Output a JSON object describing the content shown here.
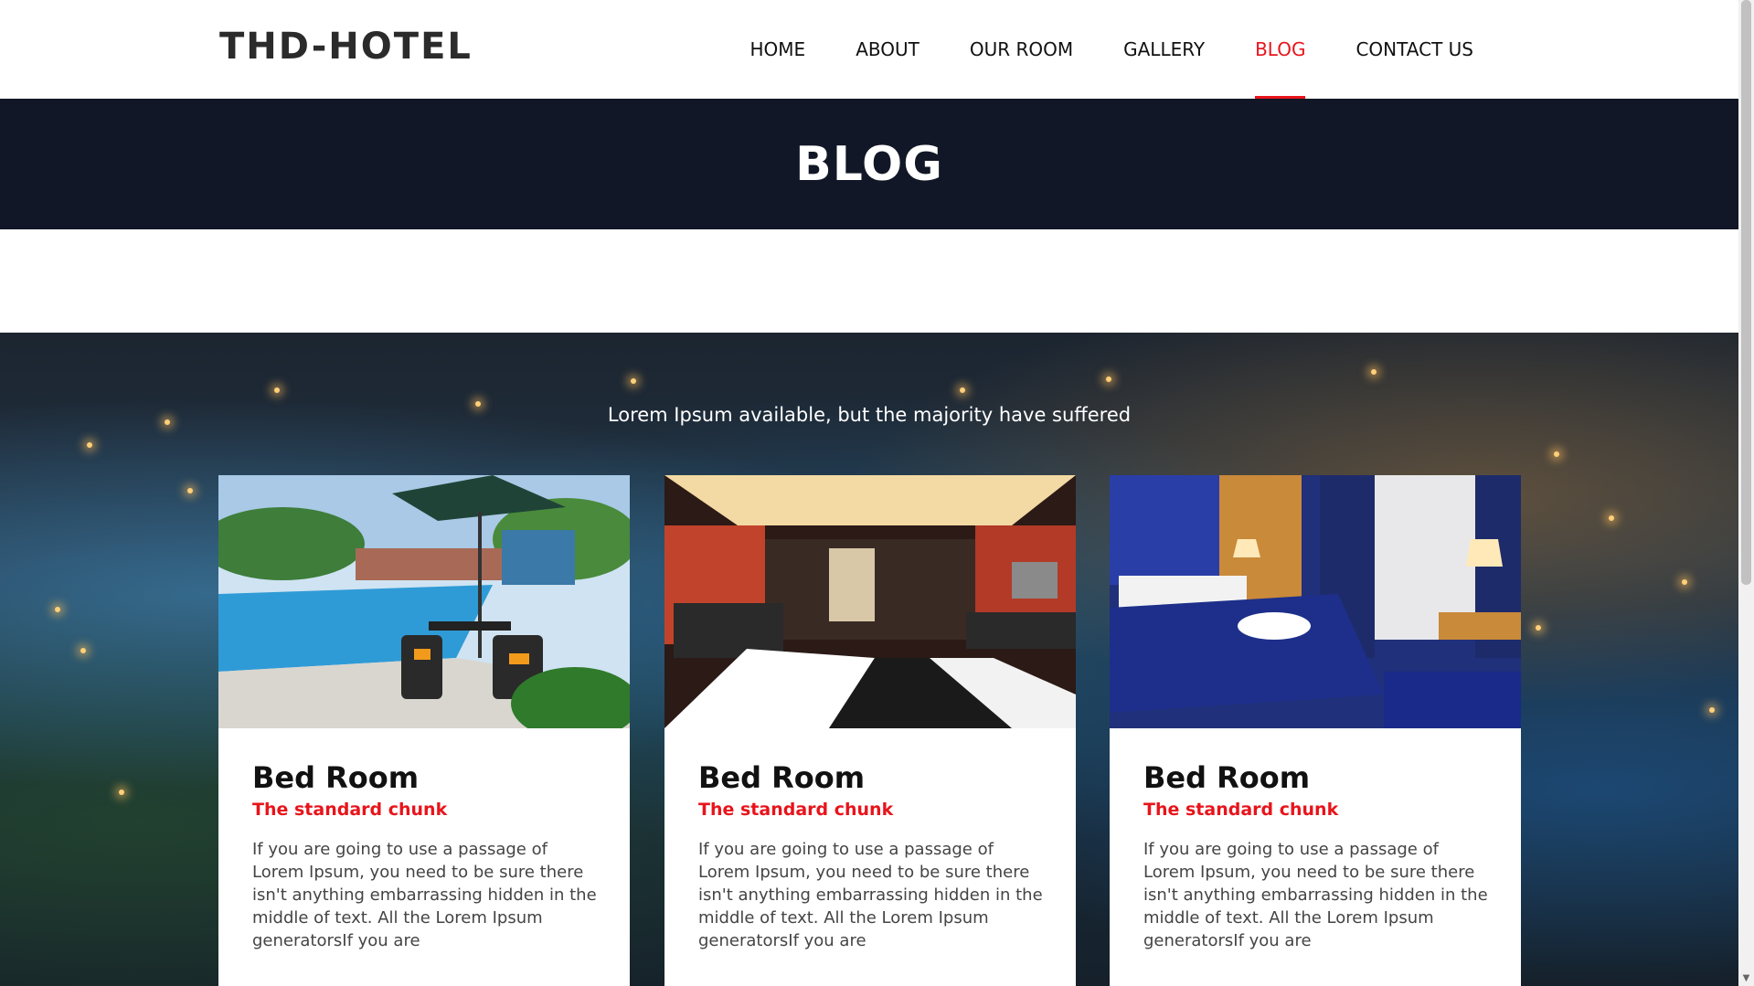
{
  "header": {
    "logo": "THD-HOTEL",
    "nav": [
      {
        "label": "HOME",
        "active": false
      },
      {
        "label": "ABOUT",
        "active": false
      },
      {
        "label": "OUR ROOM",
        "active": false
      },
      {
        "label": "GALLERY",
        "active": false
      },
      {
        "label": "BLOG",
        "active": true
      },
      {
        "label": "CONTACT US",
        "active": false
      }
    ]
  },
  "banner": {
    "title": "BLOG"
  },
  "blog": {
    "subtitle": "Lorem Ipsum available, but the majority have suffered",
    "cards": [
      {
        "image": "pool-terrace-photo",
        "title": "Bed Room",
        "subtitle": "The standard chunk",
        "text": "If you are going to use a passage of Lorem Ipsum, you need to be sure there isn't anything embarrassing hidden in the middle of text. All the Lorem Ipsum generatorsIf you are"
      },
      {
        "image": "hotel-lobby-photo",
        "title": "Bed Room",
        "subtitle": "The standard chunk",
        "text": "If you are going to use a passage of Lorem Ipsum, you need to be sure there isn't anything embarrassing hidden in the middle of text. All the Lorem Ipsum generatorsIf you are"
      },
      {
        "image": "blue-bedroom-photo",
        "title": "Bed Room",
        "subtitle": "The standard chunk",
        "text": "If you are going to use a passage of Lorem Ipsum, you need to be sure there isn't anything embarrassing hidden in the middle of text. All the Lorem Ipsum generatorsIf you are"
      }
    ]
  },
  "colors": {
    "accent": "#e8141b",
    "banner": "#111726",
    "text": "#111111"
  }
}
